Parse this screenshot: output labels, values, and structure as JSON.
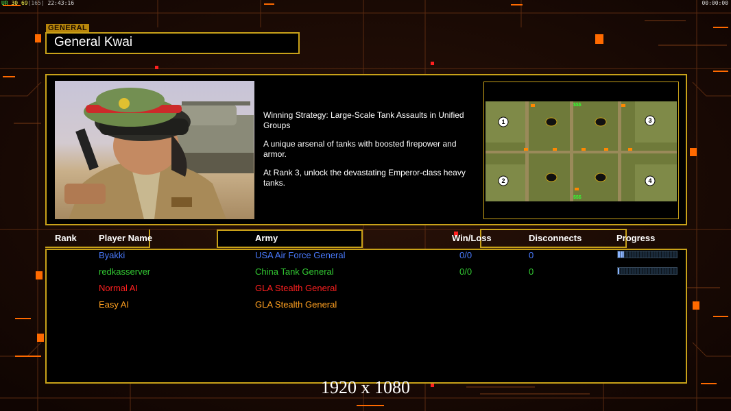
{
  "hud": {
    "left": {
      "a": "UR",
      "b": "30",
      "c": "69",
      "d": "[165]",
      "time": "22:43:16"
    },
    "right_time": "00:00:00"
  },
  "section_tag": "GENERAL",
  "general_name": "General Kwai",
  "description": [
    "Winning Strategy: Large-Scale Tank Assaults in Unified Groups",
    "A unique arsenal of tanks with boosted firepower and armor.",
    "At Rank 3, unlock the devastating Emperor-class heavy tanks."
  ],
  "map": {
    "player_markers": [
      "1",
      "2",
      "3",
      "4"
    ],
    "money_label": "$$$"
  },
  "table": {
    "headers": {
      "rank": "Rank",
      "player_name": "Player Name",
      "army": "Army",
      "win_loss": "Win/Loss",
      "disconnects": "Disconnects",
      "progress": "Progress"
    },
    "rows": [
      {
        "rank": "",
        "name": "Byakki",
        "army": "USA Air Force General",
        "win_loss": "0/0",
        "disconnects": "0",
        "progress": 0.1,
        "color": "#4a7bff"
      },
      {
        "rank": "",
        "name": "redkasserver",
        "army": "China Tank General",
        "win_loss": "0/0",
        "disconnects": "0",
        "progress": 0.02,
        "color": "#33cc33"
      },
      {
        "rank": "",
        "name": "Normal AI",
        "army": "GLA Stealth General",
        "win_loss": "",
        "disconnects": "",
        "progress": null,
        "color": "#ff2020"
      },
      {
        "rank": "",
        "name": "Easy AI",
        "army": "GLA Stealth General",
        "win_loss": "",
        "disconnects": "",
        "progress": null,
        "color": "#ffa020"
      }
    ]
  },
  "resolution_label": "1920 x 1080",
  "colors": {
    "gold": "#c9a219",
    "orange": "#ff6a00",
    "background": "#1a0a05"
  }
}
